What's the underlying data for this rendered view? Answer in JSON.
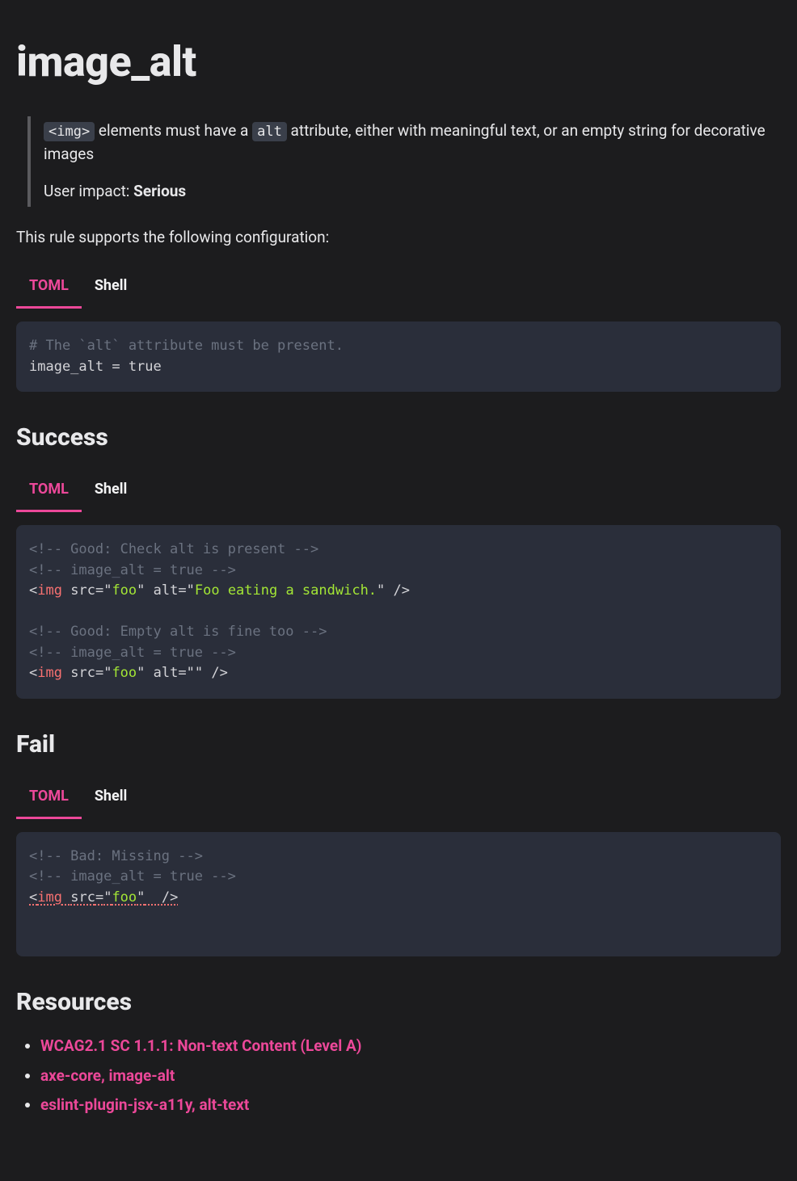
{
  "title": "image_alt",
  "summary": {
    "code1": "<img>",
    "text1": " elements must have a ",
    "code2": "alt",
    "text2": " attribute, either with meaningful text, or an empty string for decorative images",
    "impact_label": "User impact: ",
    "impact_value": "Serious"
  },
  "config_intro": "This rule supports the following configuration:",
  "tabs": {
    "toml": "TOML",
    "shell": "Shell"
  },
  "config_code": {
    "comment": "# The `alt` attribute must be present.",
    "line": "image_alt = true"
  },
  "sections": {
    "success": "Success",
    "fail": "Fail",
    "resources": "Resources"
  },
  "success_code": {
    "c1": "<!-- Good: Check alt is present -->",
    "c2": "<!-- image_alt = true -->",
    "l1": {
      "open": "<",
      "tag": "img",
      "sp": " ",
      "a1": "src",
      "eq": "=",
      "q": "\"",
      "v1": "foo",
      "a2": "alt",
      "v2": "Foo eating a sandwich.",
      "close": " />"
    },
    "c3": "<!-- Good: Empty alt is fine too -->",
    "c4": "<!-- image_alt = true -->",
    "l2": {
      "open": "<",
      "tag": "img",
      "sp": " ",
      "a1": "src",
      "eq": "=",
      "q": "\"",
      "v1": "foo",
      "a2": "alt",
      "v2": "",
      "close": " />"
    }
  },
  "fail_code": {
    "c1": "<!-- Bad: Missing -->",
    "c2": "<!-- image_alt = true -->",
    "l1": {
      "open": "<",
      "tag": "img",
      "sp": " ",
      "a1": "src",
      "eq": "=",
      "q": "\"",
      "v1": "foo",
      "close": "  />"
    }
  },
  "resources": [
    "WCAG2.1 SC 1.1.1: Non-text Content (Level A)",
    "axe-core, image-alt",
    "eslint-plugin-jsx-a11y, alt-text"
  ]
}
